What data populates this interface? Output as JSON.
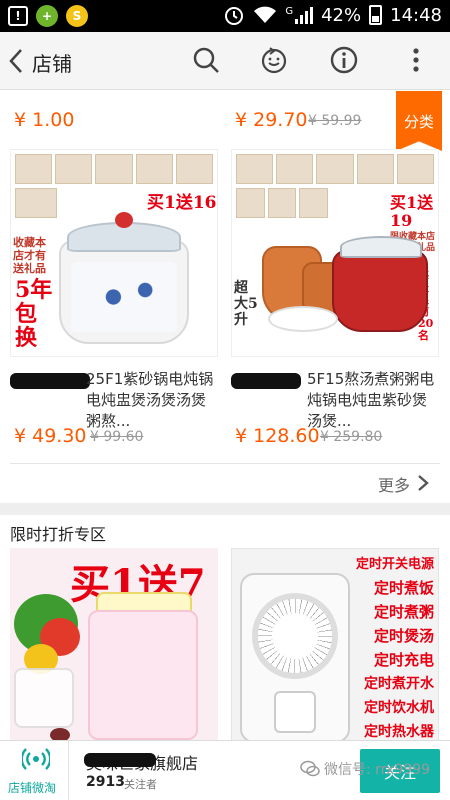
{
  "status_bar": {
    "battery": "42%",
    "time": "14:48",
    "network": "G",
    "icons": [
      "warning-icon",
      "plus-app-icon",
      "leaf-app-icon",
      "alarm-icon",
      "wifi-icon",
      "signal-icon",
      "battery-icon"
    ]
  },
  "header": {
    "title": "店铺",
    "icons": [
      "back-arrow-icon",
      "search-icon",
      "cart-icon",
      "info-icon",
      "more-vert-icon"
    ]
  },
  "top_prices": {
    "left_price": "¥ 1.00",
    "right_price": "¥ 29.70",
    "right_old": "¥ 59.99",
    "category_tag": "分类"
  },
  "products": [
    {
      "image_promo_top": "买1送16",
      "image_promo_side": "5年包换",
      "image_promo_note": "收藏本店才有送礼品",
      "name": "25F1紫砂锅电炖锅电炖盅煲汤煲汤煲粥熬...",
      "price": "¥ 49.30",
      "old_price": "¥ 99.60"
    },
    {
      "image_promo_top": "买1送19",
      "image_promo_note": "限收藏本店才有送礼品",
      "image_promo_side": "超大5升",
      "image_promo_right": "每天限前20名",
      "name": "5F15熬汤煮粥粥电炖锅电炖盅紫砂煲汤煲...",
      "price": "¥ 128.60",
      "old_price": "¥ 259.80"
    }
  ],
  "more_link": "更多",
  "section": {
    "title": "限时打折专区",
    "deal_left_promo": "买1送7",
    "deal_right_labels": [
      "定时开关电源",
      "定时煮饭",
      "定时煮粥",
      "定时煲汤",
      "定时充电",
      "定时煮开水",
      "定时饮水机",
      "定时热水器"
    ]
  },
  "bottom_bar": {
    "weitao_label": "店铺微淘",
    "shop_name": "美味世家旗舰店",
    "followers_count": "2913",
    "followers_label": "关注者",
    "follow_button": "关注",
    "watermark": "微信号: rrx9999"
  },
  "colors": {
    "accent_price": "#ff5a00",
    "category_tag": "#ff6a00",
    "follow_button": "#14b3a7",
    "promo_red": "#e60012"
  }
}
